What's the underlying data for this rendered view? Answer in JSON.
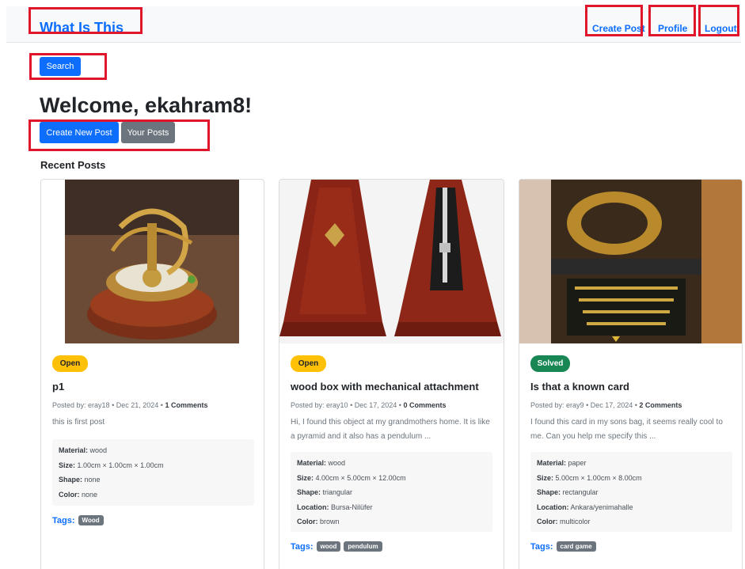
{
  "navbar": {
    "brand": "What Is This",
    "create_post": "Create Post",
    "profile": "Profile",
    "logout": "Logout"
  },
  "search_button": "Search",
  "welcome": "Welcome, ekahram8!",
  "actions": {
    "create_new_post": "Create New Post",
    "your_posts": "Your Posts"
  },
  "section_title": "Recent Posts",
  "colors": {
    "primary": "#0d6efd",
    "secondary": "#6c757d",
    "open": "#ffc107",
    "solved": "#198754",
    "highlight": "#e0162b"
  },
  "posts": [
    {
      "status": "Open",
      "title": "p1",
      "author": "eray18",
      "date": "Dec 21, 2024",
      "comments": "1 Comments",
      "description": "this is first post",
      "image": "brass-sundial-compass",
      "material": "wood",
      "size": "1.00cm × 1.00cm × 1.00cm",
      "shape": "none",
      "color": "none",
      "tags": [
        "Wood"
      ]
    },
    {
      "status": "Open",
      "title": "wood box with mechanical attachment",
      "author": "eray10",
      "date": "Dec 17, 2024",
      "comments": "0 Comments",
      "description": "Hi, I found this object at my grandmothers home. It is like a pyramid and it also has a pendulum ...",
      "image": "wooden-metronome",
      "material": "wood",
      "size": "4.00cm × 5.00cm × 12.00cm",
      "shape": "triangular",
      "location": "Bursa-Nilüfer",
      "color": "brown",
      "tags": [
        "wood",
        "pendulum"
      ]
    },
    {
      "status": "Solved",
      "title": "Is that a known card",
      "author": "eray9",
      "date": "Dec 17, 2024",
      "comments": "2 Comments",
      "description": "I found this card in my sons bag, it seems really cool to me. Can you help me specify this ...",
      "image": "ring-card",
      "material": "paper",
      "size": "5.00cm × 1.00cm × 8.00cm",
      "shape": "rectangular",
      "location": "Ankara/yenimahalle",
      "color": "multicolor",
      "tags": [
        "card game"
      ]
    }
  ],
  "labels": {
    "posted_by": "Posted by:",
    "material": "Material:",
    "size": "Size:",
    "shape": "Shape:",
    "location": "Location:",
    "color": "Color:",
    "tags": "Tags:"
  }
}
